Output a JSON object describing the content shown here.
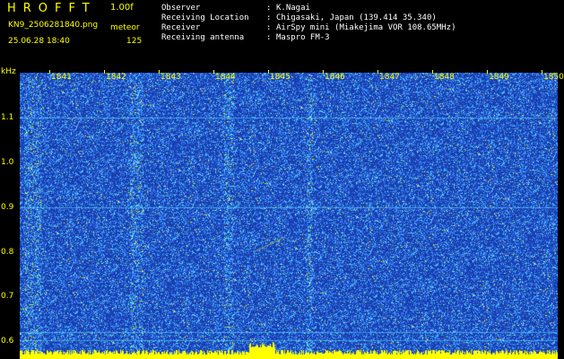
{
  "header": {
    "logo": "HROFFT",
    "version": "1.00f",
    "filename": "KN9_2506281840.png",
    "mode": "meteor",
    "datetime": "25.06.28 18:40",
    "count": "125"
  },
  "info": [
    {
      "label": "Observer",
      "value": "K.Nagai"
    },
    {
      "label": "Receiving Location",
      "value": "Chigasaki, Japan (139.414 35.340)"
    },
    {
      "label": "Receiver",
      "value": "AirSpy mini (Miakejima VOR 108.65MHz)"
    },
    {
      "label": "Receiving antenna",
      "value": "Maspro FM-3"
    }
  ],
  "colon": ":",
  "spectrogram": {
    "y_unit": "kHz",
    "y_ticks": [
      "1.1",
      "1.0",
      "0.9",
      "0.8",
      "0.7",
      "0.6"
    ],
    "x_ticks": [
      "1841",
      "1842",
      "1843",
      "1844",
      "1845",
      "1846",
      "1847",
      "1848",
      "1849",
      "1850"
    ],
    "colors": {
      "background": "#1a3fb0",
      "noise_light": "#3a8cff",
      "noise_cyan": "#55e0ff",
      "noise_yellow": "#ffff00",
      "noise_white": "#ffffff",
      "label": "#ffff00"
    }
  }
}
